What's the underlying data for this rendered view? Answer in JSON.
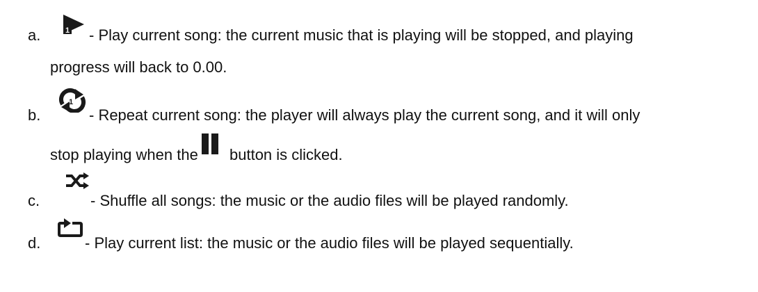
{
  "items": [
    {
      "marker": "a.",
      "icon": "play-current-song-icon",
      "text_line1": "- Play current song: the current music that is playing will be stopped, and playing",
      "text_line2": "progress will back to 0.00."
    },
    {
      "marker": "b.",
      "icon": "repeat-current-song-icon",
      "text_line1": "- Repeat current song: the player will always play the current song, and it will only",
      "text_line2_before": "stop playing when the",
      "inline_icon": "pause-icon",
      "text_line2_after": "button is clicked."
    },
    {
      "marker": "c.",
      "icon": "shuffle-icon",
      "text_line1": "- Shuffle all songs: the music or the audio files will be played randomly."
    },
    {
      "marker": "d.",
      "icon": "play-current-list-icon",
      "text_line1": "- Play current list: the music or the audio files will be played sequentially."
    }
  ]
}
